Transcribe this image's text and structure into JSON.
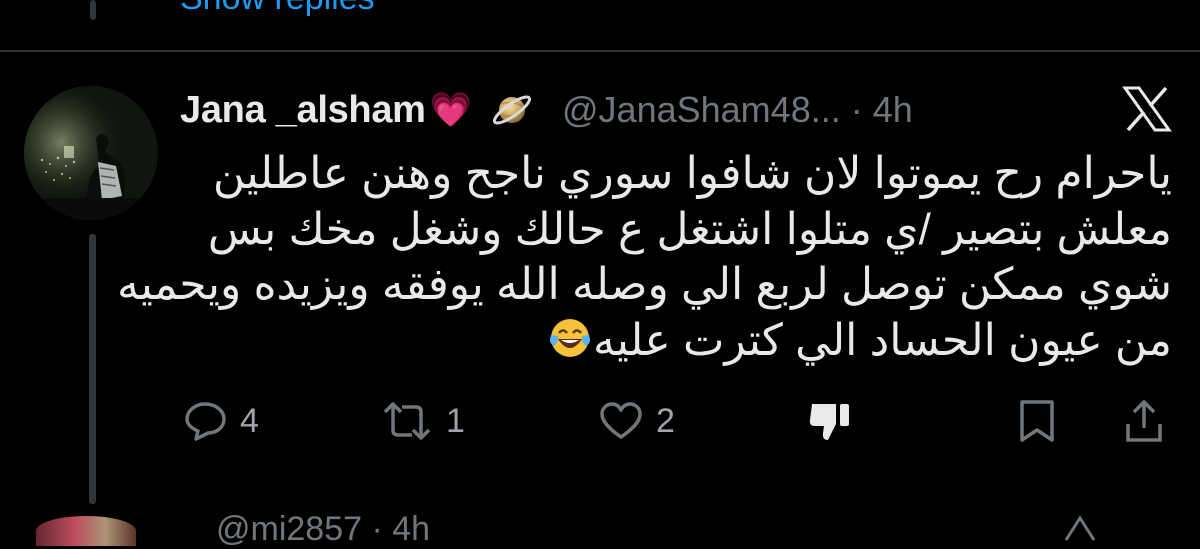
{
  "previous_reply": {
    "show_replies_label": "Show replies"
  },
  "tweet": {
    "display_name": "Jana _alsham",
    "name_emoji": "💗",
    "handle": "@JanaSham48...",
    "separator": "·",
    "time": "4h",
    "text_lines": [
      "ياحرام رح يموتوا لان شافوا سوري ناجح وهنن عاطلين",
      "معلش بتصير /ي متلوا اشتغل ع حالك وشغل مخك بس",
      "شوي ممكن توصل لربع الي وصله الله يوفقه ويزيده ويحميه",
      "من عيون الحساد الي كترت عليه"
    ],
    "text_end_emoji": "laughing-tears-emoji",
    "actions": {
      "reply_count": "4",
      "retweet_count": "1",
      "like_count": "2"
    }
  },
  "next_reply": {
    "handle": "@mi2857 · 4h"
  },
  "icons": {
    "badge": "ringed-planet-icon",
    "platform": "x-logo-icon",
    "reply": "speech-bubble-icon",
    "retweet": "retweet-arrows-icon",
    "like": "heart-outline-icon",
    "dislike": "thumbs-down-icon",
    "bookmark": "bookmark-icon",
    "share": "share-upload-icon"
  },
  "colors": {
    "background": "#000000",
    "text": "#e7e9ea",
    "muted": "#71767b",
    "link": "#1d9bf0",
    "divider": "#2f3336",
    "heart_emoji": "#ff4fb5"
  }
}
